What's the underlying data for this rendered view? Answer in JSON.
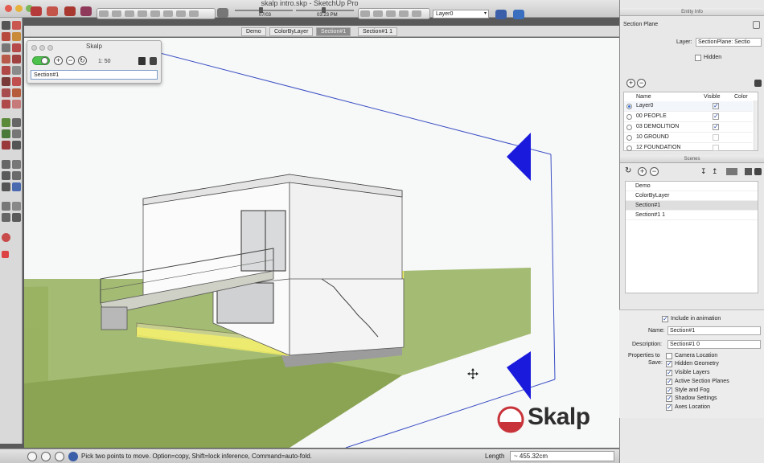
{
  "window": {
    "title": "skalp intro.skp - SketchUp Pro",
    "shadow_date": "07/03",
    "shadow_time": "03:23 PM",
    "layer_dropdown": "Layer0"
  },
  "scene_tabs": [
    {
      "label": "Demo",
      "active": false
    },
    {
      "label": "ColorByLayer",
      "active": false
    },
    {
      "label": "Section#1",
      "active": true
    },
    {
      "label": "Section#1 1",
      "active": false
    }
  ],
  "skalp": {
    "title": "Skalp",
    "scale": "1: 50",
    "section_input": "Section#1",
    "logo_text": "Skalp"
  },
  "status": {
    "hint": "Pick two points to move.  Option=copy, Shift=lock inference, Command=auto-fold.",
    "length_label": "Length",
    "length_value": "~ 455.32cm"
  },
  "entity_info": {
    "pane_title": "Entity Info",
    "entity_type": "Section Plane",
    "layer_label": "Layer:",
    "layer_value": "SectionPlane: Sectio",
    "hidden_label": "Hidden"
  },
  "layers": {
    "headers": {
      "name": "Name",
      "visible": "Visible",
      "color": "Color"
    },
    "rows": [
      {
        "name": "Layer0",
        "active": true,
        "visible": true
      },
      {
        "name": "00 PEOPLE",
        "active": false,
        "visible": true
      },
      {
        "name": "03 DEMOLITION",
        "active": false,
        "visible": true
      },
      {
        "name": "10 GROUND",
        "active": false,
        "visible": false
      },
      {
        "name": "12 FOUNDATION",
        "active": false,
        "visible": false
      }
    ]
  },
  "scenes": {
    "pane_title": "Scenes",
    "items": [
      {
        "name": "Demo",
        "selected": false
      },
      {
        "name": "ColorByLayer",
        "selected": false
      },
      {
        "name": "Section#1",
        "selected": true
      },
      {
        "name": "Section#1 1",
        "selected": false
      }
    ],
    "include_in_animation": "Include in animation",
    "name_label": "Name:",
    "name_value": "Section#1",
    "description_label": "Description:",
    "description_value": "Section#1 0",
    "properties_label": "Properties to",
    "save_label": "Save:",
    "properties": [
      {
        "label": "Camera Location",
        "checked": false
      },
      {
        "label": "Hidden Geometry",
        "checked": true
      },
      {
        "label": "Visible Layers",
        "checked": true
      },
      {
        "label": "Active Section Planes",
        "checked": true
      },
      {
        "label": "Style and Fog",
        "checked": true
      },
      {
        "label": "Shadow Settings",
        "checked": true
      },
      {
        "label": "Axes Location",
        "checked": true
      }
    ]
  },
  "colors": {
    "accent_blue": "#1a1adc",
    "section_yellow": "#f4f26a",
    "grass": "#8ea85a",
    "logo_red": "#c8333a"
  }
}
